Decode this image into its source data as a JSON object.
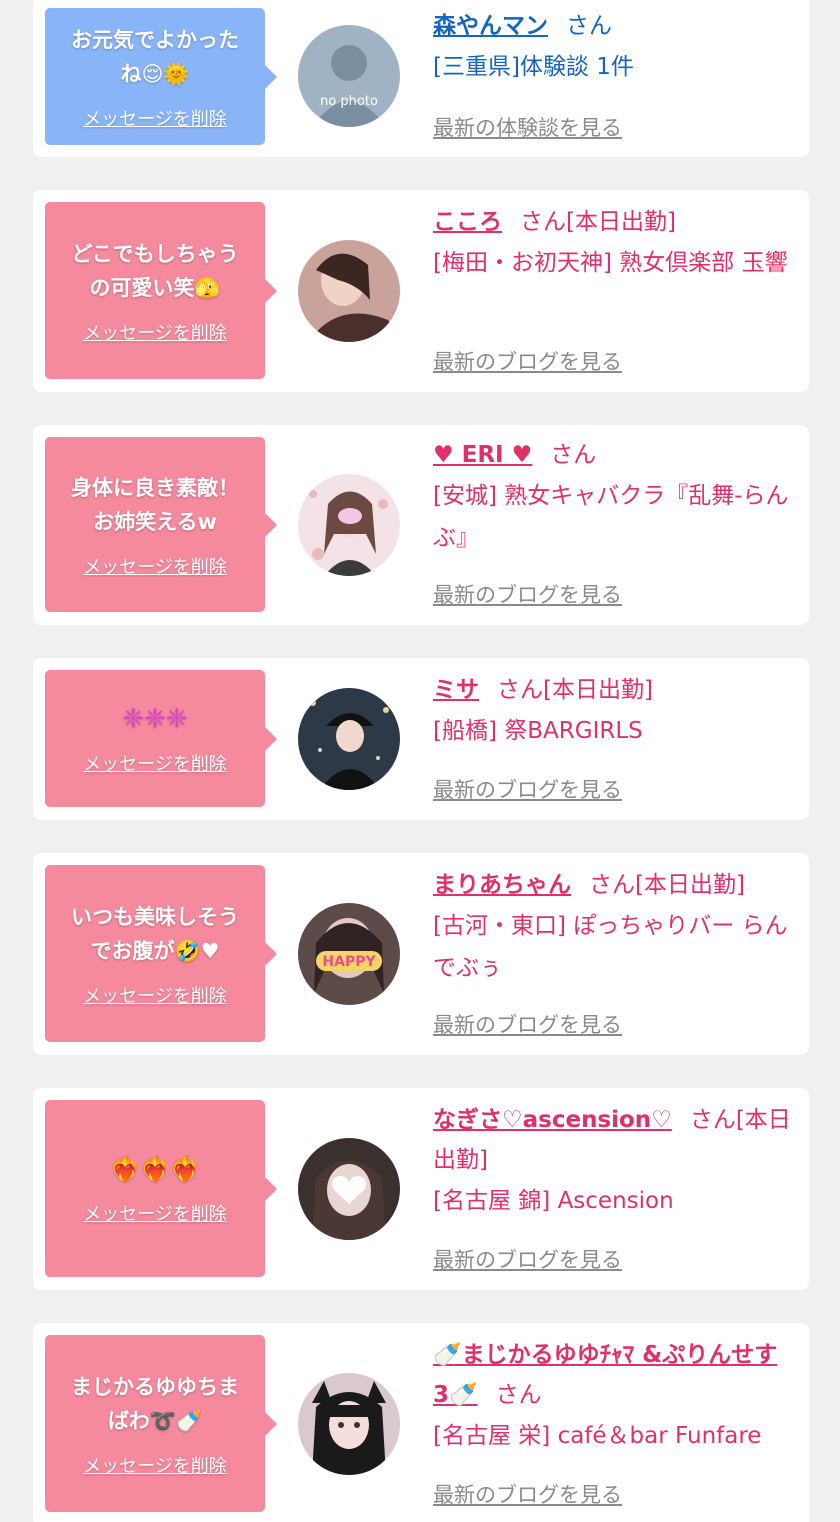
{
  "entries": [
    {
      "message": "お元気でよかったね😌🌞",
      "delete_label": "メッセージを削除",
      "name": "森やんマン",
      "suffix": "さん",
      "detail": "[三重県]体験談 1件",
      "link": "最新の体験談を見る",
      "avatar_text": "no photo",
      "bubble_color": "#8ab4f8",
      "accent": "#1565c0"
    },
    {
      "message": "どこでもしちゃうの可愛い笑🫣",
      "delete_label": "メッセージを削除",
      "name": "こころ",
      "suffix": "さん[本日出勤]",
      "detail": "[梅田・お初天神] 熟女倶楽部 玉響",
      "link": "最新のブログを見る",
      "bubble_color": "#f5899d",
      "accent": "#e0306a"
    },
    {
      "message": "身体に良き素敵！お姉笑えるw",
      "delete_label": "メッセージを削除",
      "name": "♥ ERI ♥",
      "suffix": "さん",
      "detail": "[安城] 熟女キャバクラ『乱舞-らんぶ』",
      "link": "最新のブログを見る",
      "bubble_color": "#f5899d",
      "accent": "#e0306a"
    },
    {
      "message": "❈❈❈",
      "delete_label": "メッセージを削除",
      "name": "ミサ",
      "suffix": "さん[本日出勤]",
      "detail": "[船橋] 祭BARGIRLS",
      "link": "最新のブログを見る",
      "bubble_color": "#f5899d",
      "accent": "#e0306a"
    },
    {
      "message": "いつも美味しそうでお腹が🤣♥",
      "delete_label": "メッセージを削除",
      "name": "まりあちゃん",
      "suffix": "さん[本日出勤]",
      "detail": "[古河・東口] ぽっちゃりバー らんでぶぅ",
      "link": "最新のブログを見る",
      "avatar_text": "HAPPY",
      "bubble_color": "#f5899d",
      "accent": "#e0306a"
    },
    {
      "message": "❤‍🔥❤‍🔥❤‍🔥",
      "delete_label": "メッセージを削除",
      "name": "なぎさ♡ascension♡",
      "suffix": "さん[本日出勤]",
      "detail": "[名古屋 錦] Ascension",
      "link": "最新のブログを見る",
      "bubble_color": "#f5899d",
      "accent": "#e0306a"
    },
    {
      "message": "まじかるゆゆちまばわ➰🍼",
      "delete_label": "メッセージを削除",
      "name": "🍼まじかるゆゆﾁｬﾏ &ぷりんせす3🍼",
      "suffix": "さん",
      "detail": "[名古屋 栄] café＆bar Funfare",
      "link": "最新のブログを見る",
      "bubble_color": "#f5899d",
      "accent": "#e0306a"
    }
  ]
}
